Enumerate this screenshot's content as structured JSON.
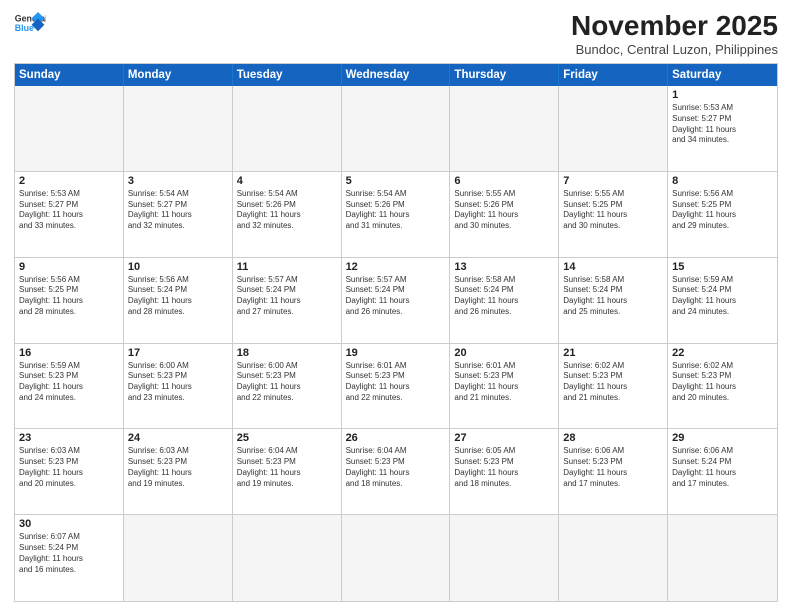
{
  "header": {
    "logo_general": "General",
    "logo_blue": "Blue",
    "month": "November 2025",
    "location": "Bundoc, Central Luzon, Philippines"
  },
  "day_headers": [
    "Sunday",
    "Monday",
    "Tuesday",
    "Wednesday",
    "Thursday",
    "Friday",
    "Saturday"
  ],
  "weeks": [
    [
      {
        "day": "",
        "info": ""
      },
      {
        "day": "",
        "info": ""
      },
      {
        "day": "",
        "info": ""
      },
      {
        "day": "",
        "info": ""
      },
      {
        "day": "",
        "info": ""
      },
      {
        "day": "",
        "info": ""
      },
      {
        "day": "1",
        "info": "Sunrise: 5:53 AM\nSunset: 5:27 PM\nDaylight: 11 hours\nand 34 minutes."
      }
    ],
    [
      {
        "day": "2",
        "info": "Sunrise: 5:53 AM\nSunset: 5:27 PM\nDaylight: 11 hours\nand 33 minutes."
      },
      {
        "day": "3",
        "info": "Sunrise: 5:54 AM\nSunset: 5:27 PM\nDaylight: 11 hours\nand 32 minutes."
      },
      {
        "day": "4",
        "info": "Sunrise: 5:54 AM\nSunset: 5:26 PM\nDaylight: 11 hours\nand 32 minutes."
      },
      {
        "day": "5",
        "info": "Sunrise: 5:54 AM\nSunset: 5:26 PM\nDaylight: 11 hours\nand 31 minutes."
      },
      {
        "day": "6",
        "info": "Sunrise: 5:55 AM\nSunset: 5:26 PM\nDaylight: 11 hours\nand 30 minutes."
      },
      {
        "day": "7",
        "info": "Sunrise: 5:55 AM\nSunset: 5:25 PM\nDaylight: 11 hours\nand 30 minutes."
      },
      {
        "day": "8",
        "info": "Sunrise: 5:56 AM\nSunset: 5:25 PM\nDaylight: 11 hours\nand 29 minutes."
      }
    ],
    [
      {
        "day": "9",
        "info": "Sunrise: 5:56 AM\nSunset: 5:25 PM\nDaylight: 11 hours\nand 28 minutes."
      },
      {
        "day": "10",
        "info": "Sunrise: 5:56 AM\nSunset: 5:24 PM\nDaylight: 11 hours\nand 28 minutes."
      },
      {
        "day": "11",
        "info": "Sunrise: 5:57 AM\nSunset: 5:24 PM\nDaylight: 11 hours\nand 27 minutes."
      },
      {
        "day": "12",
        "info": "Sunrise: 5:57 AM\nSunset: 5:24 PM\nDaylight: 11 hours\nand 26 minutes."
      },
      {
        "day": "13",
        "info": "Sunrise: 5:58 AM\nSunset: 5:24 PM\nDaylight: 11 hours\nand 26 minutes."
      },
      {
        "day": "14",
        "info": "Sunrise: 5:58 AM\nSunset: 5:24 PM\nDaylight: 11 hours\nand 25 minutes."
      },
      {
        "day": "15",
        "info": "Sunrise: 5:59 AM\nSunset: 5:24 PM\nDaylight: 11 hours\nand 24 minutes."
      }
    ],
    [
      {
        "day": "16",
        "info": "Sunrise: 5:59 AM\nSunset: 5:23 PM\nDaylight: 11 hours\nand 24 minutes."
      },
      {
        "day": "17",
        "info": "Sunrise: 6:00 AM\nSunset: 5:23 PM\nDaylight: 11 hours\nand 23 minutes."
      },
      {
        "day": "18",
        "info": "Sunrise: 6:00 AM\nSunset: 5:23 PM\nDaylight: 11 hours\nand 22 minutes."
      },
      {
        "day": "19",
        "info": "Sunrise: 6:01 AM\nSunset: 5:23 PM\nDaylight: 11 hours\nand 22 minutes."
      },
      {
        "day": "20",
        "info": "Sunrise: 6:01 AM\nSunset: 5:23 PM\nDaylight: 11 hours\nand 21 minutes."
      },
      {
        "day": "21",
        "info": "Sunrise: 6:02 AM\nSunset: 5:23 PM\nDaylight: 11 hours\nand 21 minutes."
      },
      {
        "day": "22",
        "info": "Sunrise: 6:02 AM\nSunset: 5:23 PM\nDaylight: 11 hours\nand 20 minutes."
      }
    ],
    [
      {
        "day": "23",
        "info": "Sunrise: 6:03 AM\nSunset: 5:23 PM\nDaylight: 11 hours\nand 20 minutes."
      },
      {
        "day": "24",
        "info": "Sunrise: 6:03 AM\nSunset: 5:23 PM\nDaylight: 11 hours\nand 19 minutes."
      },
      {
        "day": "25",
        "info": "Sunrise: 6:04 AM\nSunset: 5:23 PM\nDaylight: 11 hours\nand 19 minutes."
      },
      {
        "day": "26",
        "info": "Sunrise: 6:04 AM\nSunset: 5:23 PM\nDaylight: 11 hours\nand 18 minutes."
      },
      {
        "day": "27",
        "info": "Sunrise: 6:05 AM\nSunset: 5:23 PM\nDaylight: 11 hours\nand 18 minutes."
      },
      {
        "day": "28",
        "info": "Sunrise: 6:06 AM\nSunset: 5:23 PM\nDaylight: 11 hours\nand 17 minutes."
      },
      {
        "day": "29",
        "info": "Sunrise: 6:06 AM\nSunset: 5:24 PM\nDaylight: 11 hours\nand 17 minutes."
      }
    ],
    [
      {
        "day": "30",
        "info": "Sunrise: 6:07 AM\nSunset: 5:24 PM\nDaylight: 11 hours\nand 16 minutes."
      },
      {
        "day": "",
        "info": ""
      },
      {
        "day": "",
        "info": ""
      },
      {
        "day": "",
        "info": ""
      },
      {
        "day": "",
        "info": ""
      },
      {
        "day": "",
        "info": ""
      },
      {
        "day": "",
        "info": ""
      }
    ]
  ]
}
